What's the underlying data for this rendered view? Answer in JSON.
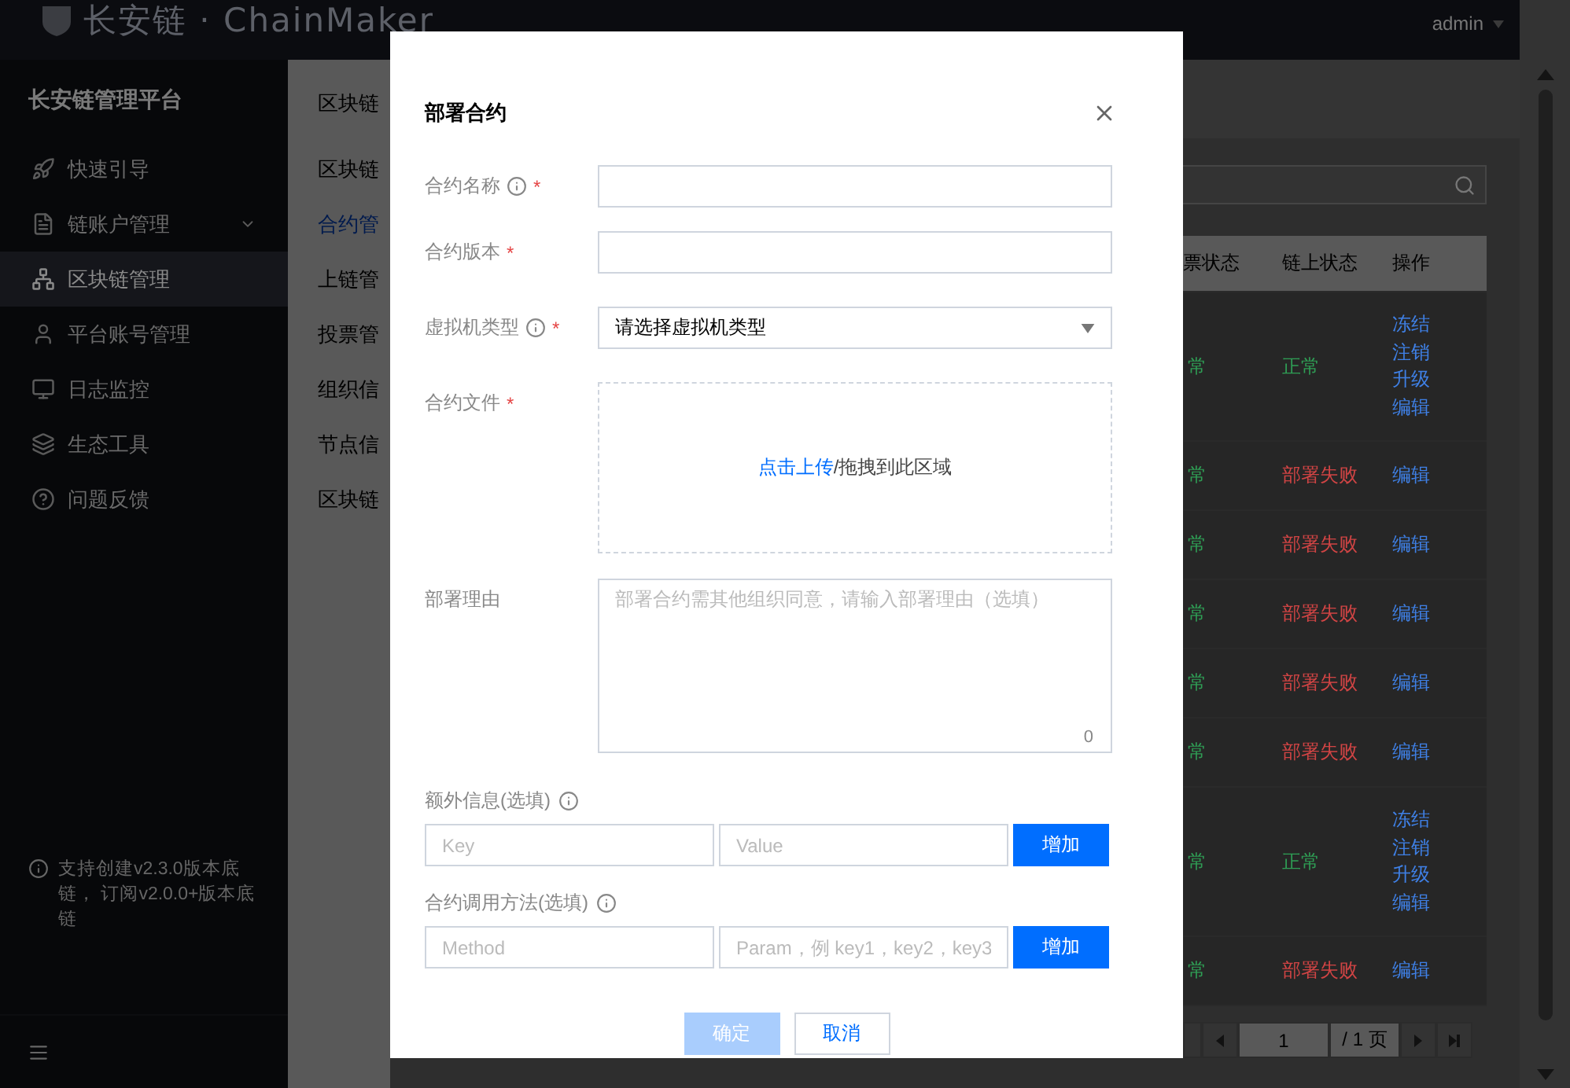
{
  "header": {
    "logo": "长安链 · ChainMaker",
    "user": "admin"
  },
  "sidebar": {
    "title": "长安链管理平台",
    "items": [
      {
        "label": "快速引导",
        "kind": "link",
        "selected": false
      },
      {
        "label": "链账户管理",
        "kind": "group",
        "selected": false
      },
      {
        "label": "区块链管理",
        "kind": "link",
        "selected": true
      },
      {
        "label": "平台账号管理",
        "kind": "link",
        "selected": false
      },
      {
        "label": "日志监控",
        "kind": "link",
        "selected": false
      },
      {
        "label": "生态工具",
        "kind": "link",
        "selected": false
      },
      {
        "label": "问题反馈",
        "kind": "link",
        "selected": false
      }
    ],
    "notice": "支持创建v2.3.0版本底链， 订阅v2.0.0+版本底链"
  },
  "subnav": {
    "title": "区块链",
    "items": [
      {
        "label": "区块链",
        "selected": false
      },
      {
        "label": "合约管",
        "selected": true
      },
      {
        "label": "上链管",
        "selected": false
      },
      {
        "label": "投票管",
        "selected": false
      },
      {
        "label": "组织信",
        "selected": false
      },
      {
        "label": "节点信",
        "selected": false
      },
      {
        "label": "区块链",
        "selected": false
      }
    ]
  },
  "table": {
    "columns": [
      "票状态",
      "链上状态",
      "操作"
    ],
    "rows": [
      {
        "vote": {
          "text": "常",
          "color": "#2f9e55"
        },
        "chain": {
          "text": "正常",
          "color": "#2f9e55"
        },
        "actions": [
          "冻结",
          "注销",
          "升级",
          "编辑"
        ]
      },
      {
        "vote": {
          "text": "常",
          "color": "#2f9e55"
        },
        "chain": {
          "text": "部署失败",
          "color": "#d04444"
        },
        "actions": [
          "编辑"
        ]
      },
      {
        "vote": {
          "text": "常",
          "color": "#2f9e55"
        },
        "chain": {
          "text": "部署失败",
          "color": "#d04444"
        },
        "actions": [
          "编辑"
        ]
      },
      {
        "vote": {
          "text": "常",
          "color": "#2f9e55"
        },
        "chain": {
          "text": "部署失败",
          "color": "#d04444"
        },
        "actions": [
          "编辑"
        ]
      },
      {
        "vote": {
          "text": "常",
          "color": "#2f9e55"
        },
        "chain": {
          "text": "部署失败",
          "color": "#d04444"
        },
        "actions": [
          "编辑"
        ]
      },
      {
        "vote": {
          "text": "常",
          "color": "#2f9e55"
        },
        "chain": {
          "text": "部署失败",
          "color": "#d04444"
        },
        "actions": [
          "编辑"
        ]
      },
      {
        "vote": {
          "text": "常",
          "color": "#2f9e55"
        },
        "chain": {
          "text": "正常",
          "color": "#2f9e55"
        },
        "actions": [
          "冻结",
          "注销",
          "升级",
          "编辑"
        ]
      },
      {
        "vote": {
          "text": "常",
          "color": "#2f9e55"
        },
        "chain": {
          "text": "部署失败",
          "color": "#d04444"
        },
        "actions": [
          "编辑"
        ]
      }
    ],
    "pagination": {
      "page": "1",
      "total": "/ 1 页"
    }
  },
  "dialog": {
    "title": "部署合约",
    "fields": [
      {
        "kind": "input",
        "label": "合约名称",
        "info": true,
        "required_mark": "*"
      },
      {
        "kind": "input",
        "label": "合约版本",
        "info": false,
        "required_mark": "*"
      },
      {
        "kind": "select",
        "label": "虚拟机类型",
        "info": true,
        "required_mark": "*",
        "placeholder": "请选择虚拟机类型"
      },
      {
        "kind": "upload",
        "label": "合约文件",
        "info": false,
        "required_mark": "*",
        "link": "点击上传",
        "hint": "/拖拽到此区域"
      },
      {
        "kind": "textarea",
        "label": "部署理由",
        "info": false,
        "placeholder": "部署合约需其他组织同意，请输入部署理由（选填）",
        "counter": "0"
      }
    ],
    "pairs": [
      {
        "label": "额外信息(选填)",
        "inputs": [
          {
            "placeholder": "Key"
          },
          {
            "placeholder": "Value"
          }
        ],
        "button": "增加"
      },
      {
        "label": "合约调用方法(选填)",
        "inputs": [
          {
            "placeholder": "Method"
          },
          {
            "placeholder": "Param，例 key1，key2，key3"
          }
        ],
        "button": "增加"
      }
    ],
    "buttons": [
      {
        "label": "确定",
        "kind": "primary",
        "disabled": true
      },
      {
        "label": "取消",
        "kind": "secondary",
        "disabled": false
      }
    ]
  }
}
